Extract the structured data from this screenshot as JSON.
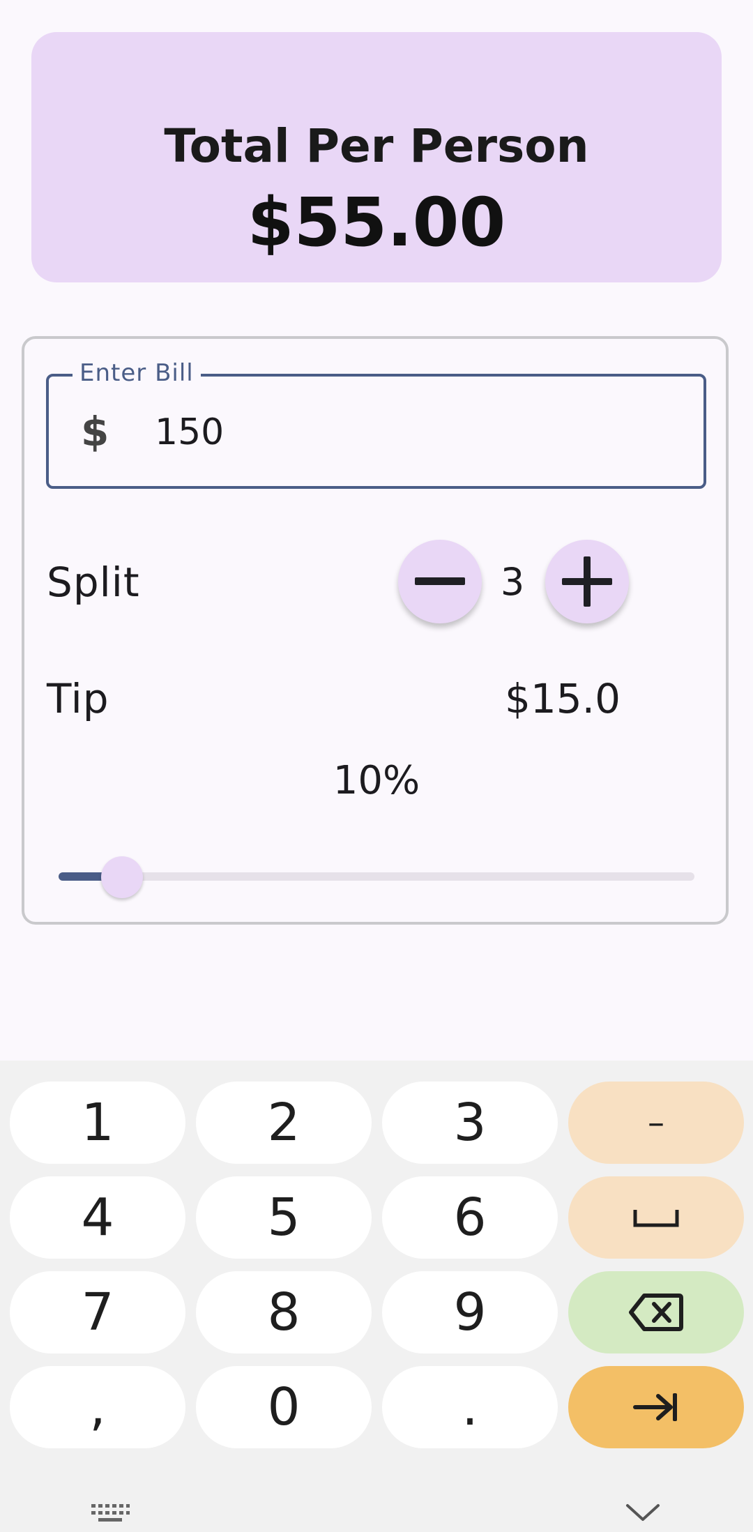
{
  "summary": {
    "title": "Total Per Person",
    "amount": "$55.00"
  },
  "bill": {
    "label": "Enter Bill",
    "currency_symbol": "$",
    "value": "150"
  },
  "split": {
    "label": "Split",
    "count": "3"
  },
  "tip": {
    "label": "Tip",
    "amount": "$15.0",
    "percent_label": "10%",
    "slider_fraction": 0.1
  },
  "colors": {
    "card_bg": "#e9d7f6",
    "accent": "#4a5d87",
    "key_func": "#f8e0c2",
    "key_delete": "#d4eac2",
    "key_go": "#f3bf66"
  },
  "keyboard": {
    "keys": [
      "1",
      "2",
      "3",
      "–",
      "4",
      "5",
      "6",
      "space-icon",
      "7",
      "8",
      "9",
      "backspace-icon",
      ",",
      "0",
      ".",
      "tab-icon"
    ],
    "k1": "1",
    "k2": "2",
    "k3": "3",
    "k_minus": "–",
    "k4": "4",
    "k5": "5",
    "k6": "6",
    "k7": "7",
    "k8": "8",
    "k9": "9",
    "k_comma": ",",
    "k0": "0",
    "k_dot": "."
  }
}
